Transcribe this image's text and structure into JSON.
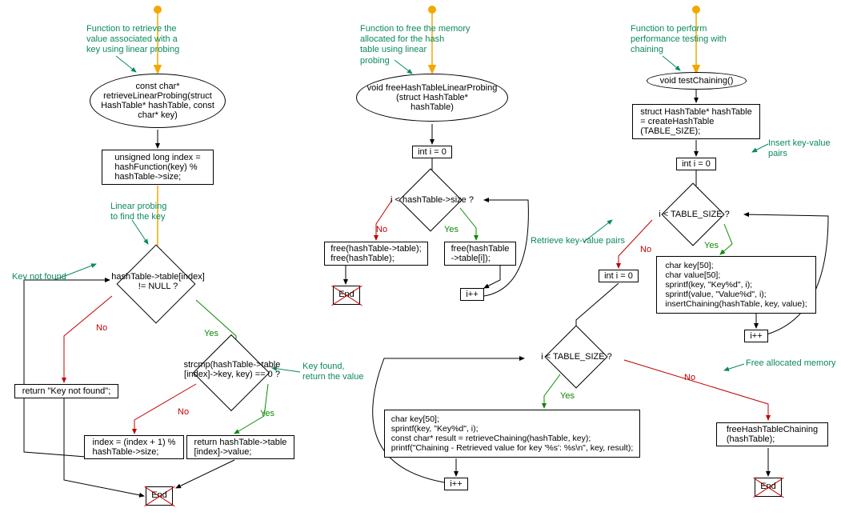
{
  "flowchart1": {
    "annot_title": "Function to retrieve the\nvalue associated with a\nkey using linear probing",
    "start": "const char*\nretrieveLinearProbing(struct\nHashTable* hashTable, const\nchar* key)",
    "box_index": "unsigned long index =\nhashFunction(key) %\nhashTable->size;",
    "annot_probe": "Linear probing\nto find the key",
    "annot_notfound": "Key not found",
    "diamond_null": "hashTable->table[index]\n!= NULL ?",
    "box_ret_notfound": "return \"Key not found\";",
    "diamond_strcmp": "strcmp(hashTable->table\n[index]->key, key) == 0 ?",
    "annot_found": "Key found,\nreturn the value",
    "box_inc_index": "index = (index + 1) %\nhashTable->size;",
    "box_ret_value": "return hashTable->table\n[index]->value;",
    "end": "End",
    "yes": "Yes",
    "no": "No"
  },
  "flowchart2": {
    "annot_title": "Function to free the memory\nallocated for the hash\ntable using linear\nprobing",
    "start": "void freeHashTableLinearProbing\n(struct HashTable*\nhashTable)",
    "box_i0": "int i = 0",
    "diamond_isize": "i < hashTable->size ?",
    "box_no": "free(hashTable->table);\nfree(hashTable);",
    "box_yes": "free(hashTable\n->table[i]);",
    "box_ipp": "i++",
    "end": "End",
    "yes": "Yes",
    "no": "No"
  },
  "flowchart3": {
    "annot_title": "Function to perform\nperformance testing with\nchaining",
    "start": "void testChaining()",
    "box_create": "struct HashTable* hashTable\n= createHashTable\n(TABLE_SIZE);",
    "annot_insert": "Insert key-value pairs",
    "box_i0": "int i = 0",
    "annot_retrieve": "Retrieve key-value pairs",
    "diamond_isize1": "i < TABLE_SIZE ?",
    "box_i0_2": "int i = 0",
    "box_insert_block": "char key[50];\nchar value[50];\nsprintf(key, \"Key%d\", i);\nsprintf(value, \"Value%d\", i);\ninsertChaining(hashTable, key, value);",
    "box_ipp1": "i++",
    "diamond_isize2": "i < TABLE_SIZE ?",
    "annot_free": "Free allocated memory",
    "box_retrieve_block": "char key[50];\nsprintf(key, \"Key%d\", i);\nconst char* result = retrieveChaining(hashTable, key);\nprintf(\"Chaining - Retrieved value for key '%s': %s\\n\", key, result);",
    "box_free": "freeHashTableChaining\n(hashTable);",
    "box_ipp2": "i++",
    "end1": "End",
    "end2": "End",
    "yes": "Yes",
    "no": "No"
  }
}
